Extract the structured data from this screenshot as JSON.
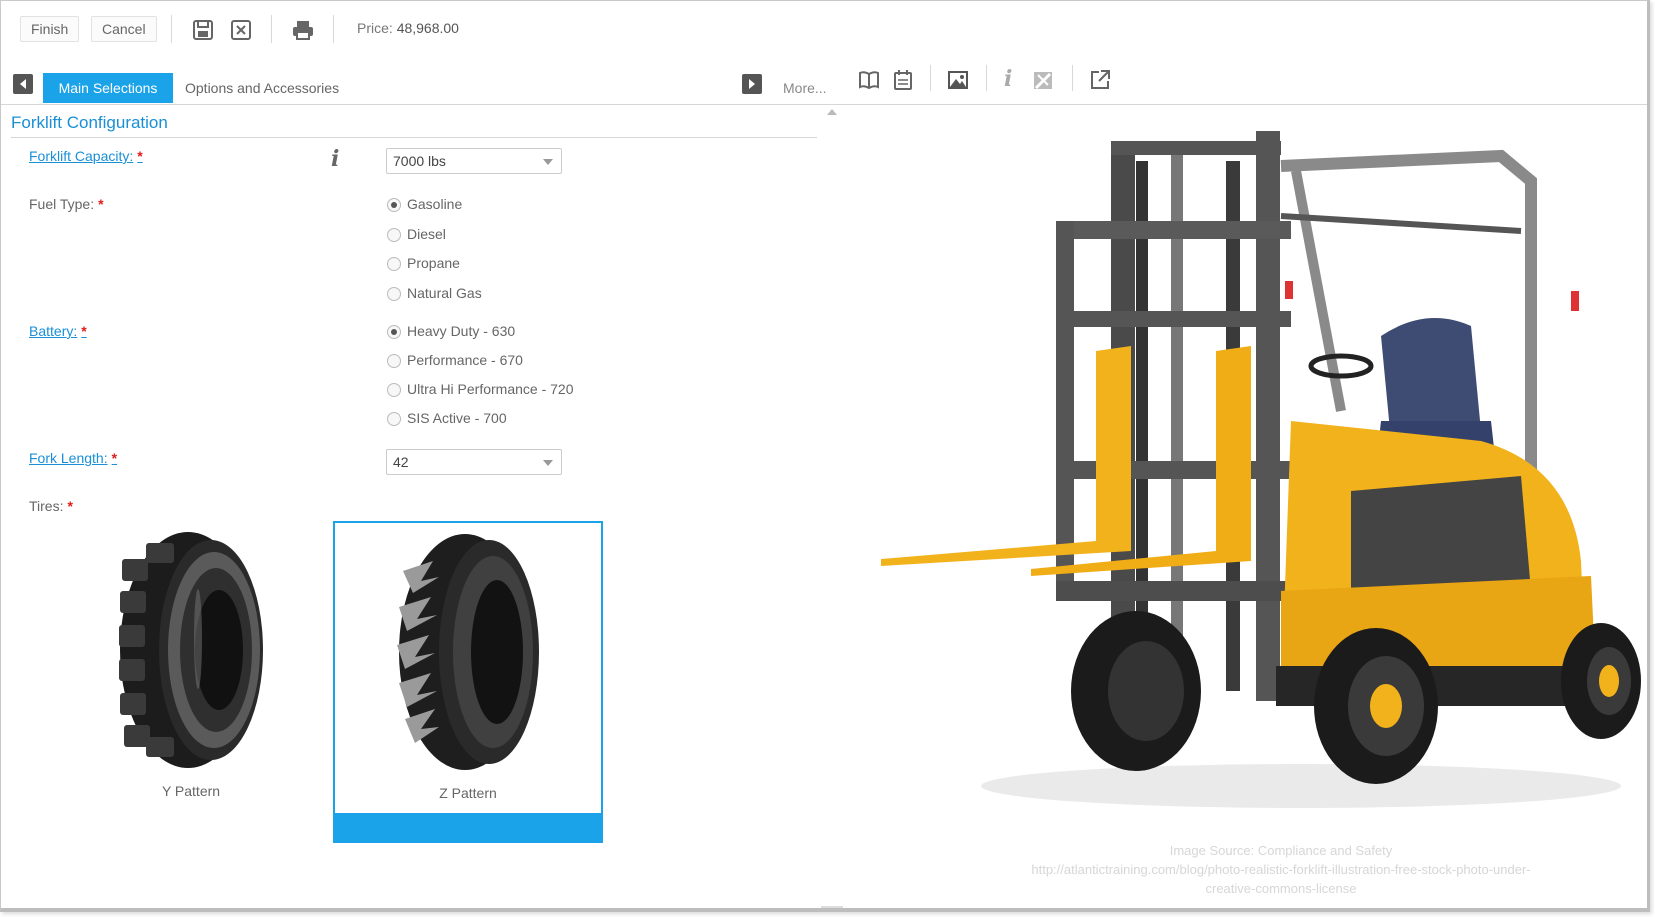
{
  "toolbar": {
    "finish_label": "Finish",
    "cancel_label": "Cancel",
    "price_label": "Price:",
    "price_value": "48,968.00",
    "icons": [
      "save-icon",
      "save-close-icon",
      "print-icon"
    ]
  },
  "tabs": {
    "items": [
      {
        "label": "Main Selections",
        "active": true
      },
      {
        "label": "Options and Accessories",
        "active": false
      }
    ],
    "more_label": "More..."
  },
  "right_toolbar": {
    "icons": [
      "book-icon",
      "calendar-icon",
      "image-icon",
      "info-icon",
      "highlight-icon",
      "popout-icon"
    ]
  },
  "section": {
    "title": "Forklift Configuration"
  },
  "fields": {
    "capacity": {
      "label": "Forklift Capacity:",
      "required_mark": "*",
      "value": "7000 lbs",
      "info_icon": "i"
    },
    "fuel": {
      "label": "Fuel Type:",
      "required_mark": "*",
      "options": [
        {
          "label": "Gasoline",
          "selected": true
        },
        {
          "label": "Diesel",
          "selected": false
        },
        {
          "label": "Propane",
          "selected": false
        },
        {
          "label": "Natural Gas",
          "selected": false
        }
      ]
    },
    "battery": {
      "label": "Battery:",
      "required_mark": "*",
      "options": [
        {
          "label": "Heavy Duty - 630",
          "selected": true
        },
        {
          "label": "Performance - 670",
          "selected": false
        },
        {
          "label": "Ultra Hi Performance - 720",
          "selected": false
        },
        {
          "label": "SIS Active - 700",
          "selected": false
        }
      ]
    },
    "fork_length": {
      "label": "Fork Length:",
      "required_mark": "*",
      "value": "42"
    },
    "tires": {
      "label": "Tires:",
      "required_mark": "*",
      "options": [
        {
          "label": "Y Pattern",
          "selected": false
        },
        {
          "label": "Z Pattern",
          "selected": true
        }
      ]
    }
  },
  "image": {
    "source_line1": "Image Source: Compliance and Safety",
    "source_line2": "http://atlantictraining.com/blog/photo-realistic-forklift-illustration-free-stock-photo-under-",
    "source_line3": "creative-commons-license"
  },
  "colors": {
    "accent": "#1aa3e8",
    "link": "#1a8fd6",
    "required": "#e01b1b",
    "forklift_yellow": "#f2b21c"
  }
}
